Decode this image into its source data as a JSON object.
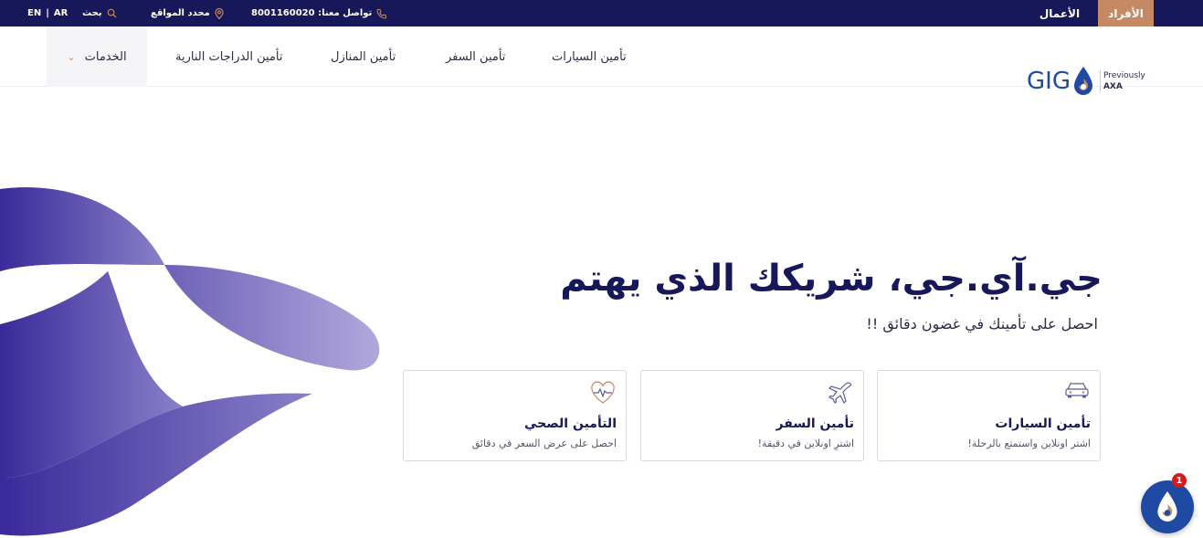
{
  "topbar": {
    "lang_en": "EN",
    "lang_sep": "|",
    "lang_ar": "AR",
    "search_label": "بحث",
    "locator_label": "محدد المواقع",
    "contact_label": "تواصل معنا: 8001160020",
    "segment_business": "الأعمال",
    "segment_individuals": "الأفراد"
  },
  "nav": {
    "services": "الخدمات",
    "moto": "تأمين الدراجات النارية",
    "home": "تأمين المنازل",
    "travel": "تأمين السفر",
    "car": "تأمين السيارات"
  },
  "logo": {
    "text": "GIG",
    "previously": "Previously",
    "former": "AXA"
  },
  "hero": {
    "title": "جي.آي.جي، شريكك الذي يهتم",
    "subtitle": "احصل على تأمينك في غضون دقائق !!"
  },
  "cards": [
    {
      "icon": "car-icon",
      "title": "تأمين السيارات",
      "subtitle": "اشتر اونلاين واستمتع بالرحلة!"
    },
    {
      "icon": "airplane-icon",
      "title": "تأمين السفر",
      "subtitle": "اشترِ اونلاين في دقيقة!"
    },
    {
      "icon": "heart-pulse-icon",
      "title": "التأمين الصحي",
      "subtitle": "احصل على عرض السعر في دقائق"
    }
  ],
  "chat": {
    "badge": "1"
  },
  "colors": {
    "navy": "#16185a",
    "accent": "#c58a63",
    "brand_blue": "#1f4aa3",
    "purple": "#4a3aa8"
  }
}
